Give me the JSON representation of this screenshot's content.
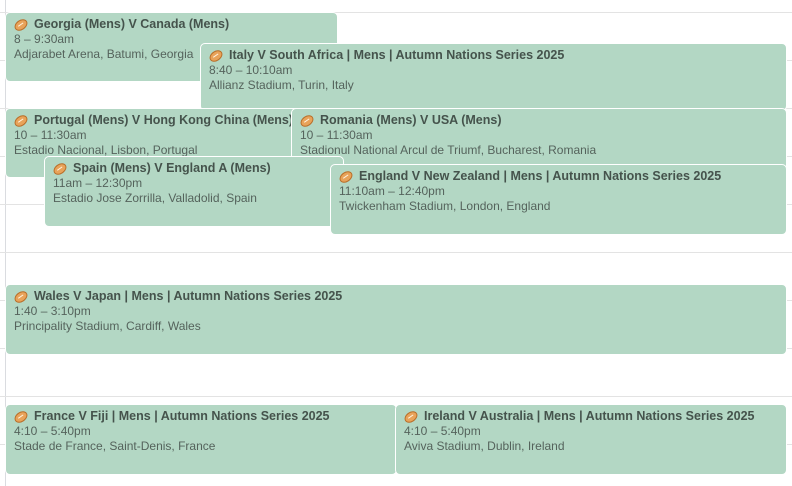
{
  "events": [
    {
      "title": "Georgia (Mens) V Canada (Mens)",
      "time": "8 – 9:30am",
      "location": "Adjarabet Arena, Batumi, Georgia",
      "icon": "rugby-ball-icon"
    },
    {
      "title": "Italy V South Africa | Mens | Autumn Nations Series 2025",
      "time": "8:40 – 10:10am",
      "location": "Allianz Stadium, Turin, Italy",
      "icon": "rugby-ball-icon"
    },
    {
      "title": "Portugal (Mens) V Hong Kong China (Mens)",
      "time": "10 – 11:30am",
      "location": "Estadio Nacional, Lisbon, Portugal",
      "icon": "rugby-ball-icon"
    },
    {
      "title": "Romania (Mens) V USA (Mens)",
      "time": "10 – 11:30am",
      "location": "Stadionul National Arcul de Triumf, Bucharest, Romania",
      "icon": "rugby-ball-icon"
    },
    {
      "title": "Spain (Mens) V England A (Mens)",
      "time": "11am – 12:30pm",
      "location": "Estadio Jose Zorrilla, Valladolid, Spain",
      "icon": "rugby-ball-icon"
    },
    {
      "title": "England V New Zealand | Mens | Autumn Nations Series 2025",
      "time": "11:10am – 12:40pm",
      "location": "Twickenham Stadium, London, England",
      "icon": "rugby-ball-icon"
    },
    {
      "title": "Wales V Japan | Mens | Autumn Nations Series 2025",
      "time": "1:40 – 3:10pm",
      "location": "Principality Stadium, Cardiff, Wales",
      "icon": "rugby-ball-icon"
    },
    {
      "title": "France V Fiji | Mens | Autumn Nations Series 2025",
      "time": "4:10 – 5:40pm",
      "location": "Stade de France, Saint-Denis, France",
      "icon": "rugby-ball-icon"
    },
    {
      "title": "Ireland V Australia | Mens | Autumn Nations Series 2025",
      "time": "4:10 – 5:40pm",
      "location": "Aviva Stadium, Dublin, Ireland",
      "icon": "rugby-ball-icon"
    }
  ],
  "colors": {
    "event_background": "#b3d7c4",
    "event_text": "#45534c",
    "grid_line": "#e3e3e3"
  }
}
